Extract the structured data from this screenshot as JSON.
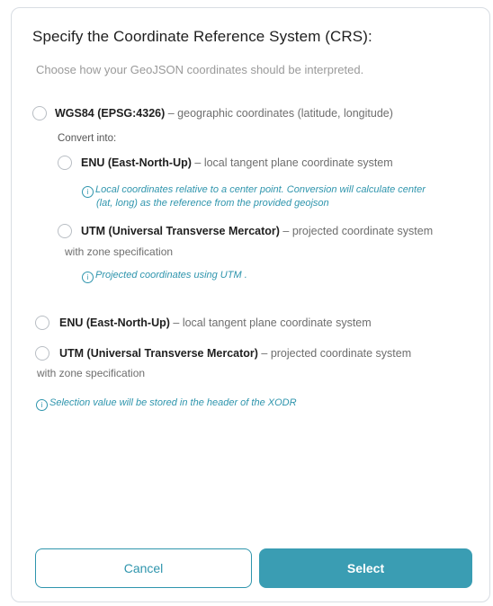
{
  "dialog": {
    "title": "Specify the Coordinate Reference System (CRS):",
    "subtitle": "Choose how your GeoJSON coordinates should be interpreted."
  },
  "wgs84": {
    "label": "WGS84 (EPSG:4326)",
    "desc": " – geographic coordinates (latitude, longitude)",
    "convert_label": "Convert into:",
    "enu": {
      "label": "ENU (East-North-Up)",
      "desc": " – local tangent plane coordinate system",
      "info_line1": "Local coordinates relative to a center point. Conversion will calculate  center",
      "info_line2": "(lat, long) as the reference from the provided geojson"
    },
    "utm": {
      "label": "UTM (Universal Transverse Mercator)",
      "desc": " – projected coordinate system",
      "desc2": "with zone specification",
      "info": "Projected coordinates using UTM ."
    }
  },
  "enu": {
    "label": "ENU (East-North-Up)",
    "desc": " – local tangent plane coordinate system"
  },
  "utm": {
    "label": "UTM (Universal Transverse Mercator)",
    "desc": " – projected coordinate system",
    "desc2": "with zone specification"
  },
  "footer_info": "Selection value will be stored in the header of the XODR",
  "info_icon_glyph": "i",
  "buttons": {
    "cancel": "Cancel",
    "select": "Select"
  },
  "colors": {
    "accent": "#2f95ad",
    "select_bg": "#3a9db3"
  }
}
